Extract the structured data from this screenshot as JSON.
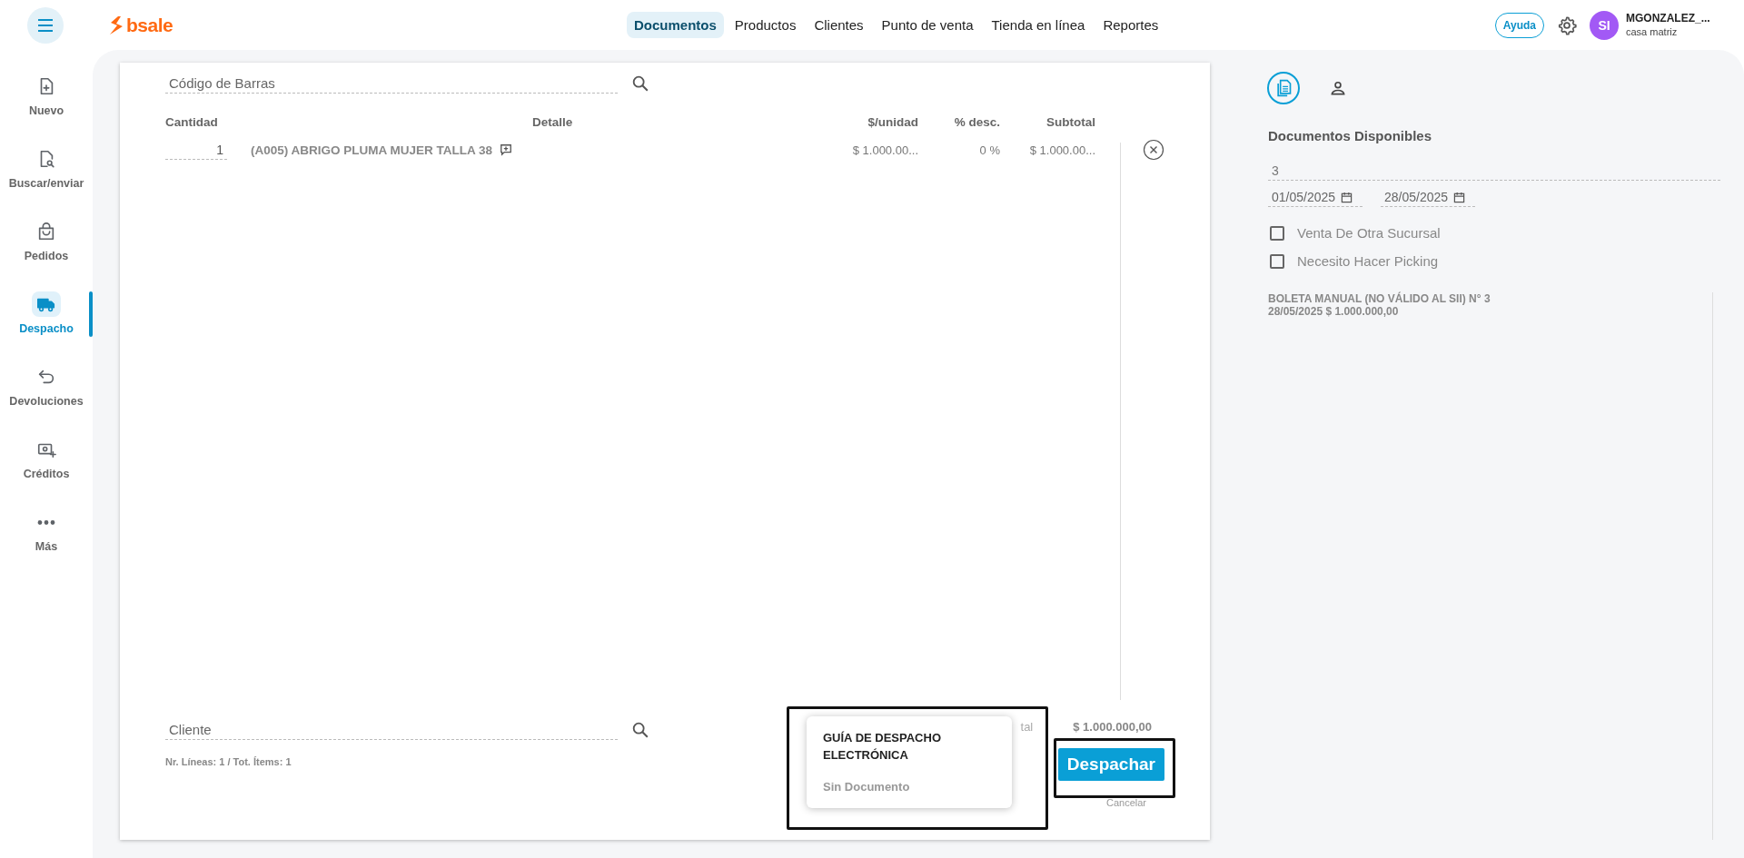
{
  "topbar": {
    "logo": "bsale",
    "nav": [
      {
        "label": "Documentos",
        "selected": true
      },
      {
        "label": "Productos",
        "selected": false
      },
      {
        "label": "Clientes",
        "selected": false
      },
      {
        "label": "Punto de venta",
        "selected": false
      },
      {
        "label": "Tienda en línea",
        "selected": false
      },
      {
        "label": "Reportes",
        "selected": false
      }
    ],
    "help": "Ayuda",
    "user": {
      "initials": "SI",
      "name": "MGONZALEZ_...",
      "branch": "casa matriz"
    }
  },
  "sidebar": {
    "items": [
      {
        "label": "Nuevo",
        "selected": false
      },
      {
        "label": "Buscar/enviar",
        "selected": false
      },
      {
        "label": "Pedidos",
        "selected": false
      },
      {
        "label": "Despacho",
        "selected": true
      },
      {
        "label": "Devoluciones",
        "selected": false
      },
      {
        "label": "Créditos",
        "selected": false
      },
      {
        "label": "Más",
        "selected": false
      }
    ]
  },
  "document": {
    "barcode_placeholder": "Código de Barras",
    "columns": [
      "Cantidad",
      "Detalle",
      "$/unidad",
      "% desc.",
      "Subtotal"
    ],
    "rows": [
      {
        "quantity": "1",
        "detail": "(A005) ABRIGO PLUMA MUJER TALLA 38",
        "unit_price": "$ 1.000.00...",
        "discount": "0 %",
        "subtotal": "$ 1.000.00..."
      }
    ],
    "client_placeholder": "Cliente",
    "summary": "Nr. Líneas: 1 / Tot. Ítems: 1",
    "total_label": "tal",
    "total": "$ 1.000.000,00",
    "submit": "Despachar",
    "cancel": "Cancelar"
  },
  "popup_menu": {
    "items": [
      {
        "label": "GUÍA DE DESPACHO ELECTRÓNICA",
        "disabled": false
      },
      {
        "label": "Sin Documento",
        "disabled": true
      }
    ]
  },
  "right_panel": {
    "tabs": [
      {
        "selected": true
      },
      {
        "selected": false
      }
    ],
    "title": "Documentos Disponibles",
    "number": "3",
    "date_from": "01/05/2025",
    "date_to": "28/05/2025",
    "checkboxes": [
      {
        "label": "Venta De Otra Sucursal",
        "checked": false
      },
      {
        "label": "Necesito Hacer Picking",
        "checked": false
      }
    ],
    "documents": [
      {
        "title": "BOLETA MANUAL (NO VÁLIDO AL SII) N° 3",
        "detail": "28/05/2025 $ 1.000.000,00"
      }
    ]
  }
}
